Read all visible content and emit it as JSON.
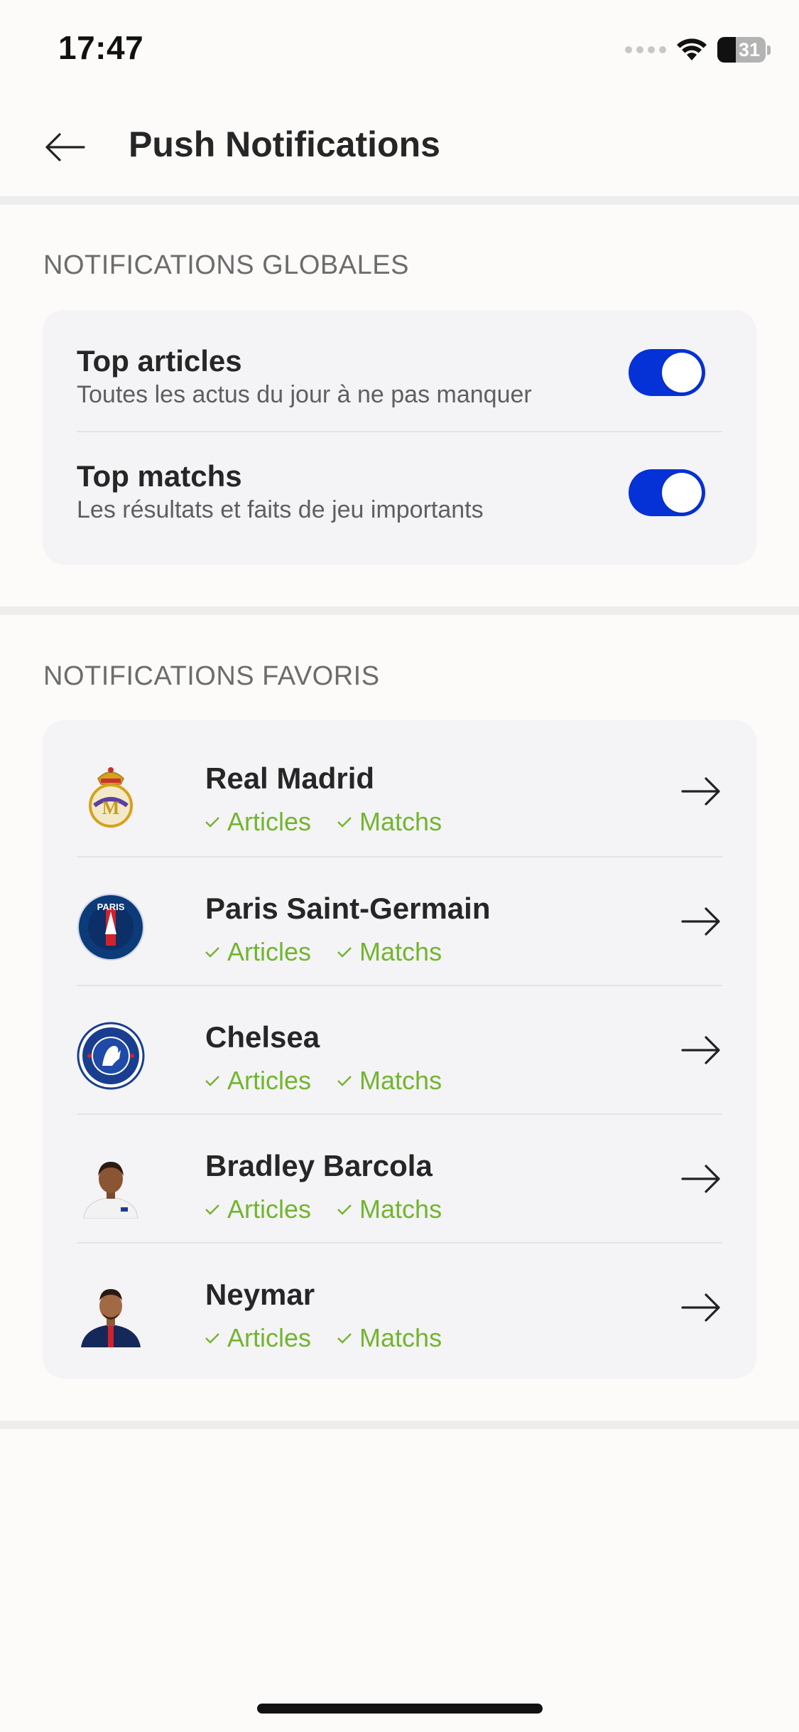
{
  "status_bar": {
    "time": "17:47",
    "battery": "31"
  },
  "header": {
    "title": "Push Notifications",
    "back_icon": "arrow-left-icon"
  },
  "global_notifications": {
    "section_title": "NOTIFICATIONS GLOBALES",
    "items": [
      {
        "title": "Top articles",
        "subtitle": "Toutes les actus du jour à ne pas manquer",
        "enabled": true
      },
      {
        "title": "Top matchs",
        "subtitle": "Les résultats et faits de jeu importants",
        "enabled": true
      }
    ]
  },
  "favorite_notifications": {
    "section_title": "NOTIFICATIONS FAVORIS",
    "items": [
      {
        "name": "Real Madrid",
        "tag_articles": "Articles",
        "tag_matchs": "Matchs",
        "avatar": "real-madrid-crest-icon"
      },
      {
        "name": "Paris Saint-Germain",
        "tag_articles": "Articles",
        "tag_matchs": "Matchs",
        "avatar": "psg-crest-icon"
      },
      {
        "name": "Chelsea",
        "tag_articles": "Articles",
        "tag_matchs": "Matchs",
        "avatar": "chelsea-crest-icon"
      },
      {
        "name": "Bradley Barcola",
        "tag_articles": "Articles",
        "tag_matchs": "Matchs",
        "avatar": "player-photo"
      },
      {
        "name": "Neymar",
        "tag_articles": "Articles",
        "tag_matchs": "Matchs",
        "avatar": "player-photo"
      }
    ]
  },
  "colors": {
    "toggle_on": "#0432d6",
    "tag_green": "#72b52f",
    "card_bg": "#f4f3f5"
  }
}
